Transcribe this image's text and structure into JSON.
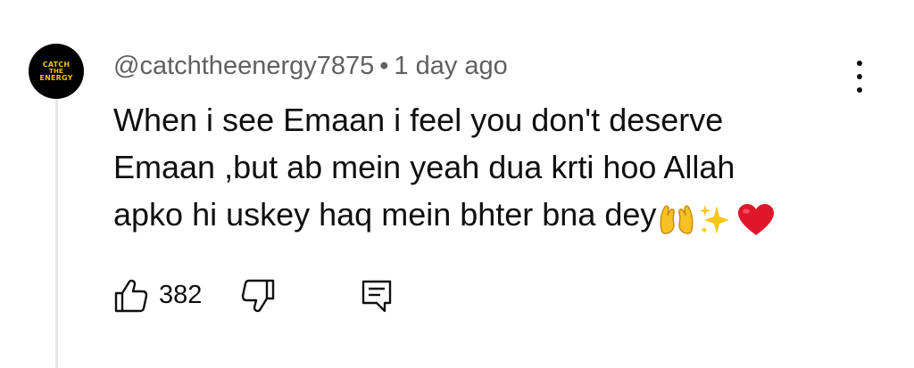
{
  "comment": {
    "author": "@catchtheenergy7875",
    "separator": "•",
    "timestamp": "1 day ago",
    "text_lines": [
      "When i see Emaan i feel you don't deserve",
      "Emaan ,but ab mein yeah dua krti hoo Allah",
      "apko hi uskey haq mein bhter bna dey"
    ],
    "emojis": [
      "open-hands-icon",
      "sparkles-icon",
      "red-heart-icon"
    ],
    "like_count": "382"
  },
  "avatar": {
    "logo_text": [
      "CATCH",
      "THE",
      "ENERGY"
    ],
    "background": "#000000",
    "text_color": "#f2c200"
  },
  "colors": {
    "text_primary": "#0f0f0f",
    "text_secondary": "#606060",
    "heart": "#e0162b",
    "sparkle": "#f7c515"
  }
}
